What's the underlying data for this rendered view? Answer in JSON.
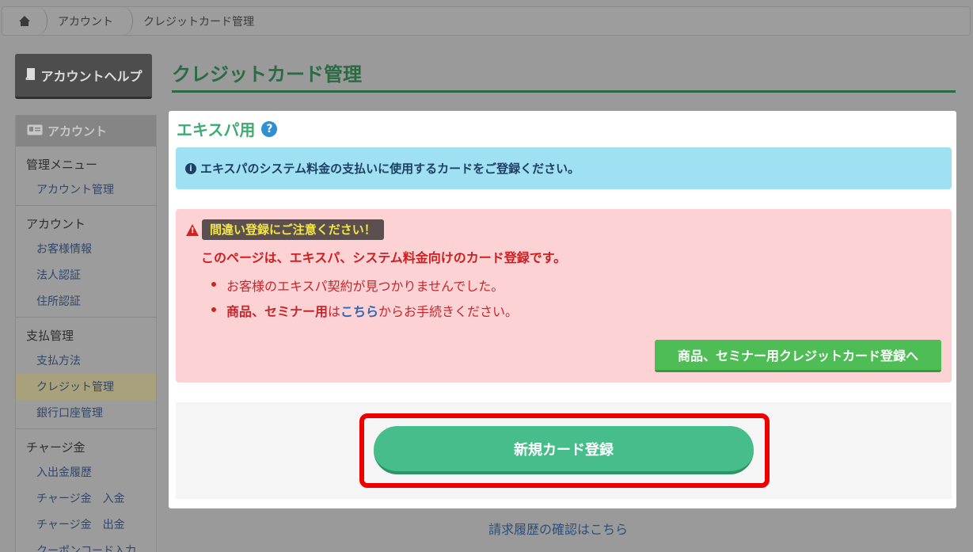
{
  "breadcrumb": {
    "home_icon": "home-icon",
    "items": [
      "アカウント",
      "クレジットカード管理"
    ]
  },
  "help_button": {
    "label": "アカウントヘルプ",
    "icon": "book-icon"
  },
  "sidebar": {
    "header": "アカウント",
    "header_icon": "id-card-icon",
    "sections": [
      {
        "title": "管理メニュー",
        "items": [
          "アカウント管理"
        ]
      },
      {
        "title": "アカウント",
        "items": [
          "お客様情報",
          "法人認証",
          "住所認証"
        ]
      },
      {
        "title": "支払管理",
        "items": [
          "支払方法",
          "クレジット管理",
          "銀行口座管理"
        ],
        "active": "クレジット管理"
      },
      {
        "title": "チャージ金",
        "items": [
          "入出金履歴",
          "チャージ金　入金",
          "チャージ金　出金",
          "クーポンコード入力"
        ]
      }
    ]
  },
  "page_title": "クレジットカード管理",
  "card": {
    "title": "エキスパ用",
    "help_icon": "question-circle-icon",
    "info_text": "エキスパのシステム料金の支払いに使用するカードをご登録ください。",
    "warning": {
      "icon": "warning-triangle-icon",
      "badge": "間違い登録にご注意ください！",
      "lead": "このページは、エキスパ、システム料金向けのカード登録です。",
      "bullet1": "お客様のエキスパ契約が見つかりませんでした。",
      "bullet2_bold": "商品、セミナー用",
      "bullet2_mid": "は",
      "bullet2_link": "こちら",
      "bullet2_end": "からお手続きください。",
      "seminar_button": "商品、セミナー用クレジットカード登録へ"
    },
    "new_card_button": "新規カード登録"
  },
  "history_link": "請求履歴の確認はこちら",
  "colors": {
    "accent_green": "#3fab73",
    "button_green": "#46bd8b",
    "highlight_red": "#ee0000",
    "warning_pink": "#fcd2d5",
    "info_blue": "#9fe0f3"
  }
}
